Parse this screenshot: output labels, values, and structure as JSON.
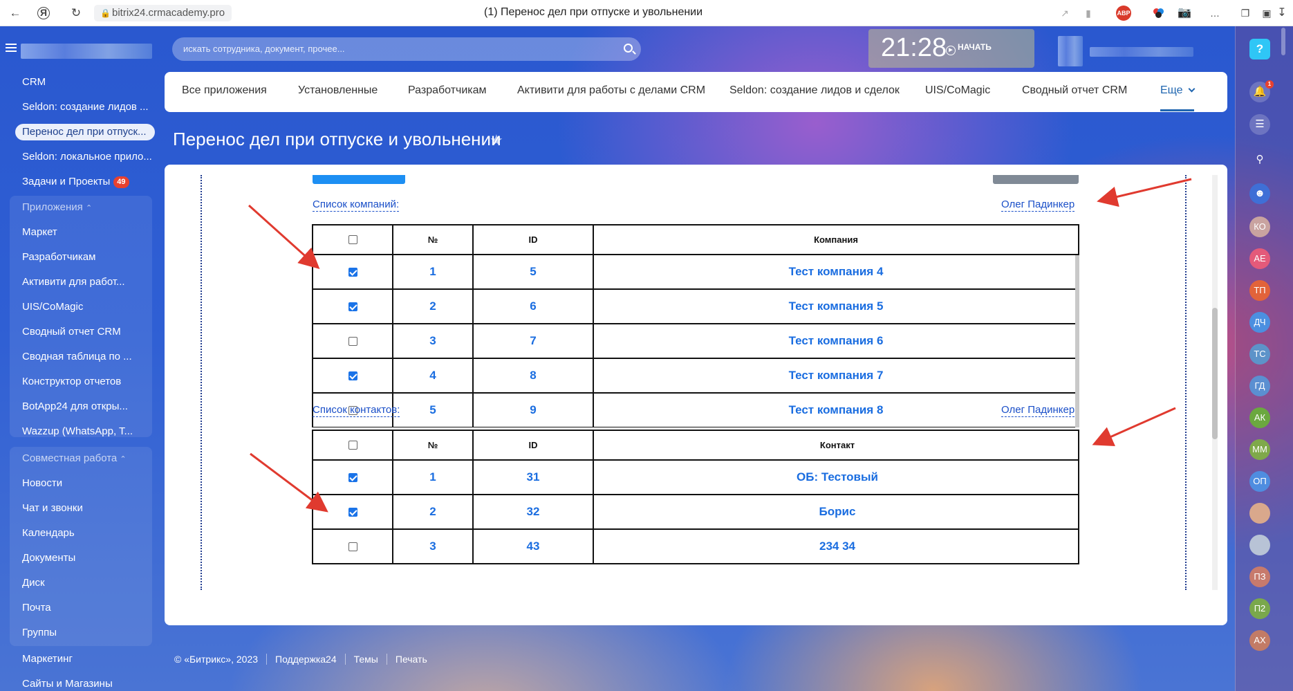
{
  "browser": {
    "url": "bitrix24.crmacademy.pro",
    "tab_title": "(1) Перенос дел при отпуске и увольнении",
    "abp_label": "ABP"
  },
  "search": {
    "placeholder": "искать сотрудника, документ, прочее..."
  },
  "timer": {
    "time": "21:28",
    "start_label": "НАЧАТЬ"
  },
  "left_menu": {
    "items": [
      {
        "label": "CRM"
      },
      {
        "label": "Seldon: создание лидов ..."
      },
      {
        "label": "Перенос дел при отпуск..."
      },
      {
        "label": "Seldon: локальное прило..."
      },
      {
        "label": "Задачи и Проекты",
        "counter": "49"
      }
    ],
    "apps_group": {
      "title": "Приложения",
      "items": [
        {
          "label": "Маркет"
        },
        {
          "label": "Разработчикам"
        },
        {
          "label": "Активити для работ..."
        },
        {
          "label": "UIS/CoMagic"
        },
        {
          "label": "Сводный отчет CRM"
        },
        {
          "label": "Сводная таблица по ..."
        },
        {
          "label": "Конструктор отчетов"
        },
        {
          "label": "BotApp24 для откры..."
        },
        {
          "label": "Wazzup (WhatsApp, T..."
        }
      ]
    },
    "collab_group": {
      "title": "Совместная работа",
      "items": [
        {
          "label": "Новости"
        },
        {
          "label": "Чат и звонки"
        },
        {
          "label": "Календарь"
        },
        {
          "label": "Документы"
        },
        {
          "label": "Диск"
        },
        {
          "label": "Почта"
        },
        {
          "label": "Группы"
        }
      ]
    },
    "after": [
      {
        "label": "Маркетинг"
      },
      {
        "label": "Сайты и Магазины"
      }
    ]
  },
  "top_nav": {
    "tabs": [
      {
        "label": "Все приложения"
      },
      {
        "label": "Установленные"
      },
      {
        "label": "Разработчикам"
      },
      {
        "label": "Активити для работы с делами CRM"
      },
      {
        "label": "Seldon: создание лидов и сделок"
      },
      {
        "label": "UIS/CoMagic"
      },
      {
        "label": "Сводный отчет CRM"
      },
      {
        "label": "Еще"
      }
    ]
  },
  "page": {
    "title": "Перенос дел при отпуске и увольнении"
  },
  "companies": {
    "list_label": "Список компаний:",
    "user_link": "Олег Падинкер",
    "columns": [
      "№",
      "ID",
      "Компания"
    ],
    "rows": [
      {
        "checked": true,
        "num": "1",
        "id": "5",
        "name": "Тест компания 4"
      },
      {
        "checked": true,
        "num": "2",
        "id": "6",
        "name": "Тест компания 5"
      },
      {
        "checked": false,
        "num": "3",
        "id": "7",
        "name": "Тест компания 6"
      },
      {
        "checked": true,
        "num": "4",
        "id": "8",
        "name": "Тест компания 7"
      },
      {
        "checked": false,
        "num": "5",
        "id": "9",
        "name": "Тест компания 8"
      }
    ]
  },
  "contacts": {
    "list_label": "Список контактов:",
    "user_link": "Олег Падинкер",
    "columns": [
      "№",
      "ID",
      "Контакт"
    ],
    "rows": [
      {
        "checked": true,
        "num": "1",
        "id": "31",
        "name": "ОБ: Тестовый"
      },
      {
        "checked": true,
        "num": "2",
        "id": "32",
        "name": "Борис"
      },
      {
        "checked": false,
        "num": "3",
        "id": "43",
        "name": "234 34"
      }
    ]
  },
  "footer": {
    "copyright": "© «Битрикс», 2023",
    "links": [
      "Поддержка24",
      "Темы",
      "Печать"
    ]
  },
  "right_bar": {
    "help": "?",
    "notifications_badge": "1",
    "avatars": [
      {
        "initials": "КО",
        "color": "#c9a3a0"
      },
      {
        "initials": "АЕ",
        "color": "#e45a7a"
      },
      {
        "initials": "ТП",
        "color": "#e2633a"
      },
      {
        "initials": "ДЧ",
        "color": "#4b8fe0"
      },
      {
        "initials": "ТС",
        "color": "#5d93c9"
      },
      {
        "initials": "ГД",
        "color": "#5b8fd1"
      },
      {
        "initials": "АК",
        "color": "#6ba83f"
      },
      {
        "initials": "ММ",
        "color": "#7fa94a"
      },
      {
        "initials": "ОП",
        "color": "#4f8de0"
      },
      {
        "initials": "",
        "color": "#d9a88c"
      },
      {
        "initials": "",
        "color": "#b8c3d6"
      },
      {
        "initials": "ПЗ",
        "color": "#c77a6c"
      },
      {
        "initials": "П2",
        "color": "#7aa84c"
      },
      {
        "initials": "АХ",
        "color": "#c27b66"
      }
    ]
  },
  "colors": {
    "accent": "#2066b0",
    "link": "#1a4fc8",
    "arrow": "#e03a2f"
  }
}
